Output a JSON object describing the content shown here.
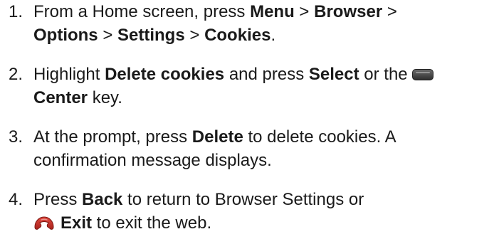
{
  "steps": [
    {
      "number": "1.",
      "t1": "From a Home screen, press ",
      "b1": "Menu",
      "t2": " > ",
      "b2": "Browser",
      "t3": " > ",
      "b3": "Options",
      "t4": " > ",
      "b4": "Settings",
      "t5": " > ",
      "b5": "Cookies",
      "t6": "."
    },
    {
      "number": "2.",
      "t1": "Highlight ",
      "b1": "Delete cookies",
      "t2": " and press ",
      "b2": "Select",
      "t3": " or the ",
      "b3": "Center",
      "t4": " key.",
      "icon": "center-key-icon"
    },
    {
      "number": "3.",
      "t1": "At the prompt, press ",
      "b1": "Delete",
      "t2": " to delete cookies. A confirmation message displays."
    },
    {
      "number": "4.",
      "t1": "Press ",
      "b1": "Back",
      "t2": " to return to Browser Settings or ",
      "b2": "Exit",
      "t3": " to exit the web.",
      "icon": "end-key-icon"
    }
  ],
  "colors": {
    "text": "#1a1a1a",
    "center_key": "#3a3a3a",
    "end_key": "#c8302a"
  }
}
